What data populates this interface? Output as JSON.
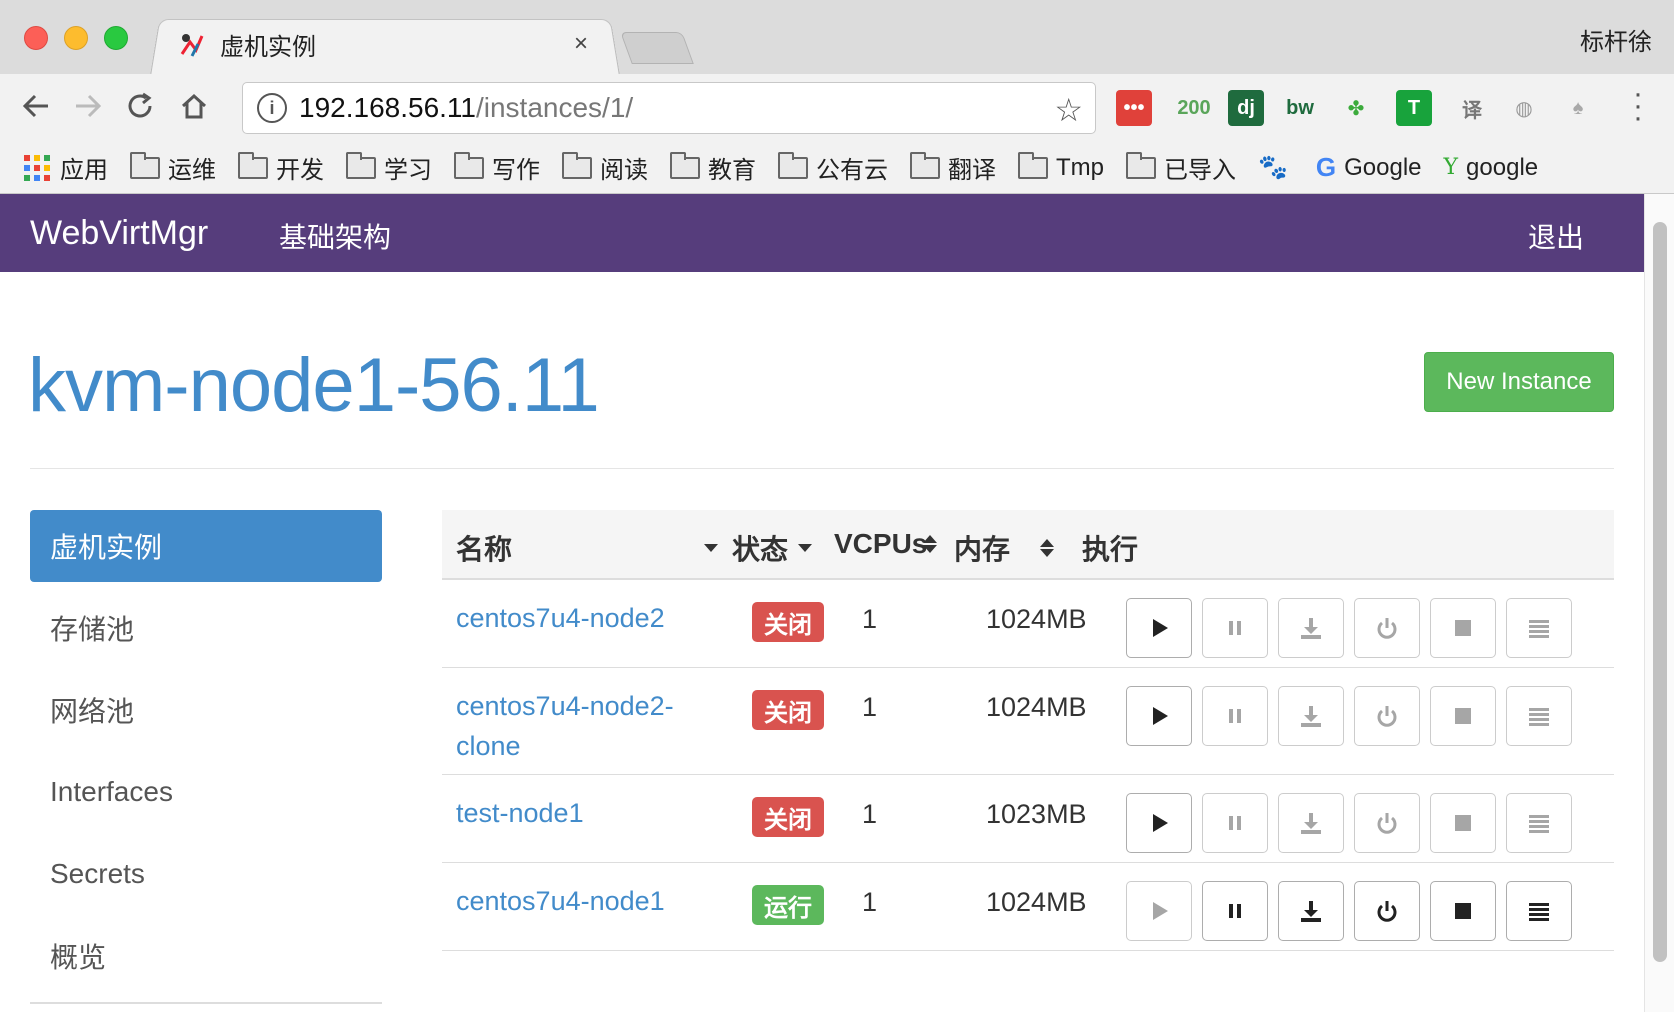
{
  "browser": {
    "tab_title": "虚机实例",
    "tab_close": "×",
    "profile_name": "标杆徐",
    "url_host": "192.168.56.11",
    "url_path": "/instances/1/",
    "extensions": [
      {
        "name": "todo-icon",
        "label": "•••",
        "bg": "#e0413a",
        "fg": "#fff"
      },
      {
        "name": "counter-200-icon",
        "label": "200",
        "bg": "transparent",
        "fg": "#5aa55a"
      },
      {
        "name": "django-icon",
        "label": "dj",
        "bg": "#1f6b3e",
        "fg": "#fff"
      },
      {
        "name": "bw-icon",
        "label": "bw",
        "bg": "transparent",
        "fg": "#1f6b3e"
      },
      {
        "name": "clover-icon",
        "label": "✤",
        "bg": "transparent",
        "fg": "#3cab3c"
      },
      {
        "name": "shield-t-icon",
        "label": "T",
        "bg": "#18a33c",
        "fg": "#fff"
      },
      {
        "name": "dict-icon",
        "label": "译",
        "bg": "transparent",
        "fg": "#777"
      },
      {
        "name": "globe-icon",
        "label": "◍",
        "bg": "transparent",
        "fg": "#9a9a9a"
      },
      {
        "name": "parachute-icon",
        "label": "♠",
        "bg": "transparent",
        "fg": "#a9a9a9"
      }
    ],
    "bookmarks": [
      {
        "type": "apps",
        "label": "应用"
      },
      {
        "type": "folder",
        "label": "运维"
      },
      {
        "type": "folder",
        "label": "开发"
      },
      {
        "type": "folder",
        "label": "学习"
      },
      {
        "type": "folder",
        "label": "写作"
      },
      {
        "type": "folder",
        "label": "阅读"
      },
      {
        "type": "folder",
        "label": "教育"
      },
      {
        "type": "folder",
        "label": "公有云"
      },
      {
        "type": "folder",
        "label": "翻译"
      },
      {
        "type": "folder",
        "label": "Tmp"
      },
      {
        "type": "folder",
        "label": "已导入"
      },
      {
        "type": "baidu",
        "label": ""
      },
      {
        "type": "google",
        "label": "Google"
      },
      {
        "type": "yahoo",
        "label": "google"
      }
    ]
  },
  "app": {
    "brand": "WebVirtMgr",
    "nav_link": "基础架构",
    "logout": "退出",
    "host_title": "kvm-node1-56.11",
    "new_instance_label": "New Instance",
    "sidebar": [
      {
        "label": "虚机实例",
        "active": true
      },
      {
        "label": "存储池",
        "active": false
      },
      {
        "label": "网络池",
        "active": false
      },
      {
        "label": "Interfaces",
        "active": false
      },
      {
        "label": "Secrets",
        "active": false
      },
      {
        "label": "概览",
        "active": false
      }
    ],
    "table": {
      "headers": {
        "name": "名称",
        "status": "状态",
        "vcpus": "VCPUs",
        "memory": "内存",
        "actions": "执行"
      },
      "rows": [
        {
          "name": "centos7u4-node2",
          "status": "关闭",
          "running": false,
          "vcpus": "1",
          "memory": "1024MB"
        },
        {
          "name": "centos7u4-node2-clone",
          "status": "关闭",
          "running": false,
          "vcpus": "1",
          "memory": "1024MB"
        },
        {
          "name": "test-node1",
          "status": "关闭",
          "running": false,
          "vcpus": "1",
          "memory": "1023MB"
        },
        {
          "name": "centos7u4-node1",
          "status": "运行",
          "running": true,
          "vcpus": "1",
          "memory": "1024MB"
        }
      ]
    }
  }
}
